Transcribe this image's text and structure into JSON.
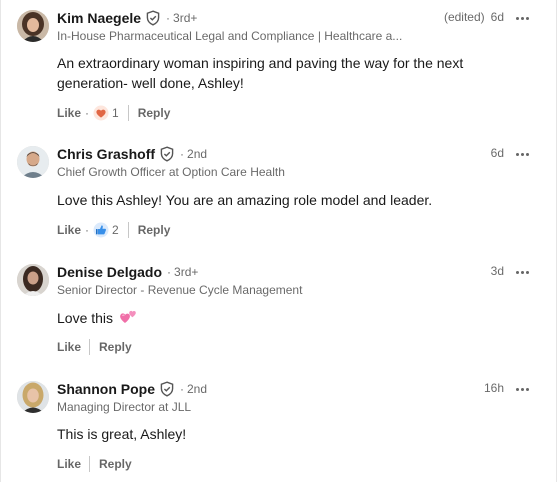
{
  "comments": [
    {
      "name": "Kim Naegele",
      "degree": "3rd+",
      "headline": "In-House Pharmaceutical Legal and Compliance | Healthcare a...",
      "edited": "(edited)",
      "time": "6d",
      "text": "An extraordinary woman inspiring and paving the way for the next generation- well done, Ashley!",
      "like_label": "Like",
      "reply_label": "Reply",
      "reaction_icon": "heart-reaction-icon",
      "reaction_count": "1"
    },
    {
      "name": "Chris Grashoff",
      "degree": "2nd",
      "headline": "Chief Growth Officer at Option Care Health",
      "time": "6d",
      "text": "Love this Ashley! You are an amazing role model and leader.",
      "like_label": "Like",
      "reply_label": "Reply",
      "reaction_icon": "thumbs-up-reaction-icon",
      "reaction_count": "2"
    },
    {
      "name": "Denise Delgado",
      "degree": "3rd+",
      "headline": "Senior Director - Revenue Cycle Management",
      "time": "3d",
      "text": "Love this",
      "text_emoji": "two-hearts-emoji",
      "like_label": "Like",
      "reply_label": "Reply"
    },
    {
      "name": "Shannon Pope",
      "degree": "2nd",
      "headline": "Managing Director at JLL",
      "time": "16h",
      "text": "This is great, Ashley!",
      "like_label": "Like",
      "reply_label": "Reply"
    }
  ],
  "separator": "·",
  "colors": {
    "text_primary": "#191919",
    "text_secondary": "#666666",
    "heart_reaction": "#e16745",
    "like_reaction": "#378fe9",
    "emoji_pink": "#f06fa8"
  }
}
